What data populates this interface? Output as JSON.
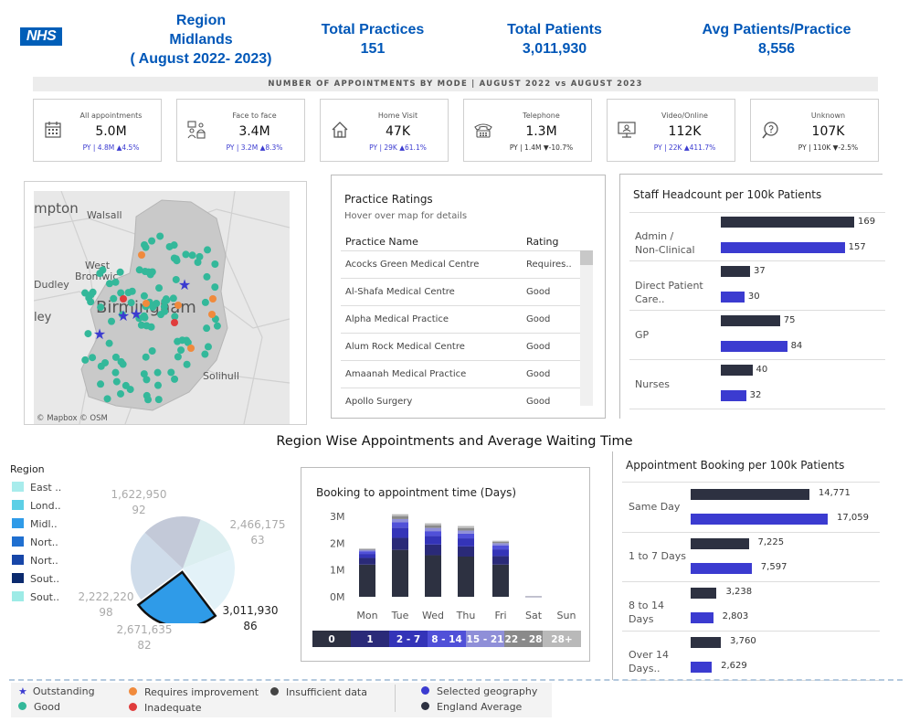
{
  "header": {
    "logo": "NHS",
    "region_label": "Region",
    "region_name": "Midlands",
    "period": "( August 2022- 2023)",
    "kpis": [
      {
        "label": "Total Practices",
        "value": "151"
      },
      {
        "label": "Total Patients",
        "value": "3,011,930"
      },
      {
        "label": "Avg Patients/Practice",
        "value": "8,556"
      }
    ]
  },
  "mode_banner": "NUMBER OF APPOINTMENTS BY MODE | AUGUST 2022 vs AUGUST 2023",
  "mode_cards": [
    {
      "label": "All appointments",
      "value": "5.0M",
      "py": "PY | 4.8M",
      "change": "▲4.5%",
      "icon": "calendar-icon",
      "tone": "blue"
    },
    {
      "label": "Face to face",
      "value": "3.4M",
      "py": "PY | 3.2M",
      "change": "▲8.3%",
      "icon": "people-icon",
      "tone": "blue"
    },
    {
      "label": "Home Visit",
      "value": "47K",
      "py": "PY | 29K",
      "change": "▲61.1%",
      "icon": "home-icon",
      "tone": "blue"
    },
    {
      "label": "Telephone",
      "value": "1.3M",
      "py": "PY | 1.4M",
      "change": "▼-10.7%",
      "icon": "telephone-icon",
      "tone": "dark"
    },
    {
      "label": "Video/Online",
      "value": "112K",
      "py": "PY | 22K",
      "change": "▲411.7%",
      "icon": "monitor-icon",
      "tone": "blue"
    },
    {
      "label": "Unknown",
      "value": "107K",
      "py": "PY | 110K",
      "change": "▼-2.5%",
      "icon": "question-icon",
      "tone": "dark"
    }
  ],
  "map": {
    "labels": [
      "mpton",
      "Walsall",
      "West",
      "Bromwic",
      "Dudley",
      "ley",
      "Birmingham",
      "Solihull"
    ],
    "attribution": "© Mapbox  © OSM"
  },
  "ratings": {
    "title": "Practice Ratings",
    "subtitle": "Hover over map for details",
    "col_name": "Practice Name",
    "col_rating": "Rating",
    "rows": [
      {
        "name": "Acocks Green Medical Centre",
        "rating": "Requires.."
      },
      {
        "name": "Al-Shafa Medical Centre",
        "rating": "Good"
      },
      {
        "name": "Alpha Medical Practice",
        "rating": "Good"
      },
      {
        "name": "Alum Rock Medical Centre",
        "rating": "Good"
      },
      {
        "name": "Amaanah Medical Practice",
        "rating": "Good"
      },
      {
        "name": "Apollo Surgery",
        "rating": "Good"
      }
    ]
  },
  "staff": {
    "title": "Staff Headcount per 100k Patients",
    "groups": [
      {
        "label": "Admin /\nNon-Clinical",
        "england": 169,
        "selected": 157
      },
      {
        "label": "Direct Patient\nCare..",
        "england": 37,
        "selected": 30
      },
      {
        "label": "GP",
        "england": 75,
        "selected": 84
      },
      {
        "label": "Nurses",
        "england": 40,
        "selected": 32
      }
    ],
    "max": 169
  },
  "region_section": {
    "title": "Region Wise Appointments and Average Waiting Time",
    "legend_title": "Region",
    "legend": [
      {
        "label": "East ..",
        "color": "#a8ecec"
      },
      {
        "label": "Lond..",
        "color": "#5ccfe6"
      },
      {
        "label": "Midl..",
        "color": "#2f9be8"
      },
      {
        "label": "Nort..",
        "color": "#1f6fd0"
      },
      {
        "label": "Nort..",
        "color": "#1746a8"
      },
      {
        "label": "Sout..",
        "color": "#0b2a6e"
      },
      {
        "label": "Sout..",
        "color": "#9debe6"
      }
    ],
    "pie_labels": [
      {
        "value": "1,622,950",
        "sub": "92"
      },
      {
        "value": "2,466,175",
        "sub": "63"
      },
      {
        "value": "2,222,220",
        "sub": "98"
      },
      {
        "value": "2,671,635",
        "sub": "82"
      },
      {
        "value": "3,011,930",
        "sub": "86"
      }
    ]
  },
  "booking": {
    "title": "Booking to appointment time (Days)",
    "yticks": [
      "3M",
      "2M",
      "1M",
      "0M"
    ],
    "days": [
      "Mon",
      "Tue",
      "Wed",
      "Thu",
      "Fri",
      "Sat",
      "Sun"
    ],
    "bins": [
      {
        "label": "0",
        "color": "#2d3141"
      },
      {
        "label": "1",
        "color": "#2a2a78"
      },
      {
        "label": "2 - 7",
        "color": "#3434b8"
      },
      {
        "label": "8 - 14",
        "color": "#5050d8"
      },
      {
        "label": "15 - 21",
        "color": "#8f8fd8"
      },
      {
        "label": "22 - 28",
        "color": "#8a8a8a"
      },
      {
        "label": "28+",
        "color": "#b9b9b9"
      }
    ]
  },
  "chart_data": [
    {
      "type": "bar",
      "title": "Booking to appointment time (Days)",
      "categories": [
        "Mon",
        "Tue",
        "Wed",
        "Thu",
        "Fri",
        "Sat",
        "Sun"
      ],
      "stacked": true,
      "ylim": [
        0,
        3000000
      ],
      "series": [
        {
          "name": "0",
          "values": [
            1200000,
            1750000,
            1550000,
            1500000,
            1200000,
            10000,
            0
          ]
        },
        {
          "name": "1",
          "values": [
            250000,
            450000,
            400000,
            380000,
            320000,
            5000,
            0
          ]
        },
        {
          "name": "2 - 7",
          "values": [
            150000,
            380000,
            320000,
            300000,
            250000,
            3000,
            0
          ]
        },
        {
          "name": "8 - 14",
          "values": [
            100000,
            200000,
            180000,
            180000,
            150000,
            1000,
            0
          ]
        },
        {
          "name": "15 - 21",
          "values": [
            50000,
            120000,
            120000,
            110000,
            80000,
            500,
            0
          ]
        },
        {
          "name": "22 - 28",
          "values": [
            30000,
            100000,
            90000,
            90000,
            50000,
            300,
            0
          ]
        },
        {
          "name": "28+",
          "values": [
            20000,
            80000,
            80000,
            80000,
            40000,
            200,
            0
          ]
        }
      ]
    },
    {
      "type": "bar",
      "title": "Staff Headcount per 100k Patients",
      "categories": [
        "Admin / Non-Clinical",
        "Direct Patient Care..",
        "GP",
        "Nurses"
      ],
      "series": [
        {
          "values": [
            169,
            37,
            75,
            40
          ],
          "color": "#2d3141"
        },
        {
          "values": [
            157,
            30,
            84,
            32
          ],
          "color": "#3b3bd0"
        }
      ]
    },
    {
      "type": "bar",
      "title": "Appointment Booking per 100k Patients",
      "categories": [
        "Same Day",
        "1 to 7 Days",
        "8 to 14 Days",
        "Over 14 Days.."
      ],
      "series": [
        {
          "values": [
            14771,
            7225,
            3238,
            3760
          ],
          "color": "#2d3141"
        },
        {
          "values": [
            17059,
            7597,
            2803,
            2629
          ],
          "color": "#3b3bd0"
        }
      ]
    },
    {
      "type": "pie",
      "values": [
        1622950,
        2466175,
        3011930,
        2671635,
        2222220
      ],
      "sub_values": [
        92,
        63,
        86,
        82,
        98
      ]
    }
  ],
  "appt": {
    "title": "Appointment Booking per 100k Patients",
    "groups": [
      {
        "label": "Same Day",
        "england": 14771,
        "selected": 17059,
        "england_txt": "14,771",
        "selected_txt": "17,059"
      },
      {
        "label": "1 to 7 Days",
        "england": 7225,
        "selected": 7597,
        "england_txt": "7,225",
        "selected_txt": "7,597"
      },
      {
        "label": "8 to 14\nDays",
        "england": 3238,
        "selected": 2803,
        "england_txt": "3,238",
        "selected_txt": "2,803"
      },
      {
        "label": "Over 14\nDays..",
        "england": 3760,
        "selected": 2629,
        "england_txt": "3,760",
        "selected_txt": "2,629"
      }
    ],
    "max": 17059
  },
  "bottom_legend": {
    "outstanding": "Outstanding",
    "good": "Good",
    "requires": "Requires improvement",
    "inadequate": "Inadequate",
    "insufficient": "Insufficient data",
    "selected": "Selected geography",
    "england": "England Average"
  },
  "colors": {
    "nhs_blue": "#005eb8",
    "england": "#2d3141",
    "selected": "#3b3bd0",
    "good": "#33b89a",
    "outstanding": "#3b3bd0",
    "requires": "#f08a3c",
    "inadequate": "#e03c3c"
  }
}
